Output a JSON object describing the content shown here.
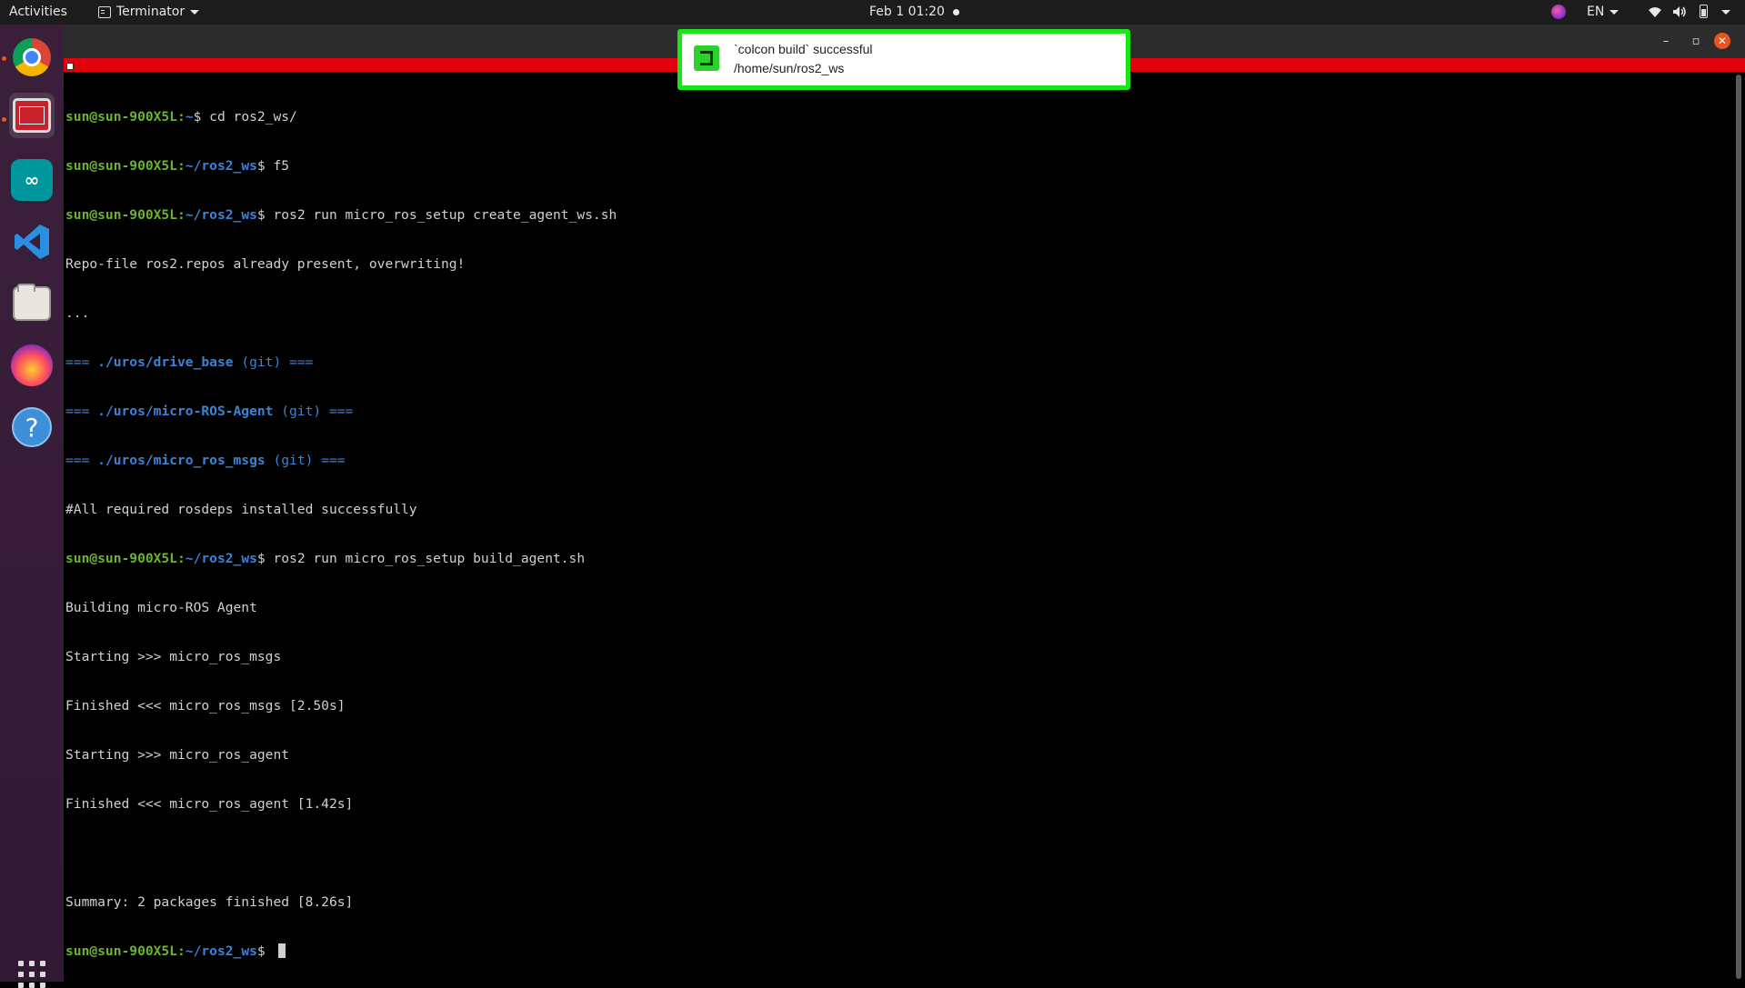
{
  "topbar": {
    "activities": "Activities",
    "app_name": "Terminator",
    "clock": "Feb 1  01:20",
    "language": "EN"
  },
  "dock": {
    "items": [
      {
        "name": "Google Chrome",
        "icon": "chrome-icon",
        "running": true
      },
      {
        "name": "Terminator",
        "icon": "terminator-icon",
        "running": true,
        "active": true
      },
      {
        "name": "Arduino IDE",
        "icon": "arduino-icon"
      },
      {
        "name": "Visual Studio Code",
        "icon": "vscode-icon"
      },
      {
        "name": "Files",
        "icon": "files-icon"
      },
      {
        "name": "Polar",
        "icon": "polar-icon"
      },
      {
        "name": "Help",
        "icon": "help-icon"
      }
    ],
    "show_apps": "apps-grid-icon"
  },
  "notification": {
    "title": "`colcon build` successful",
    "body": "/home/sun/ros2_ws",
    "icon": "colcon-notify-icon",
    "border_color": "#19e619"
  },
  "terminal": {
    "colors": {
      "prompt": "#6ab628",
      "path": "#3a84d6",
      "text": "#d0d0d0",
      "titlebar": "#e0000e"
    },
    "user_host": "sun@sun-900X5L",
    "lines": [
      {
        "p1": "sun@sun-900X5L",
        "p2": ":",
        "path": "~",
        "cmd": "$ cd ros2_ws/"
      },
      {
        "p1": "sun@sun-900X5L",
        "p2": ":",
        "path": "~/ros2_ws",
        "cmd": "$ f5"
      },
      {
        "p1": "sun@sun-900X5L",
        "p2": ":",
        "path": "~/ros2_ws",
        "cmd": "$ ros2 run micro_ros_setup create_agent_ws.sh"
      },
      {
        "text": "Repo-file ros2.repos already present, overwriting!"
      },
      {
        "text": "..."
      },
      {
        "eq": "=== ",
        "repo": "./uros/drive_base",
        "git": " (git) ==="
      },
      {
        "eq": "=== ",
        "repo": "./uros/micro-ROS-Agent",
        "git": " (git) ==="
      },
      {
        "eq": "=== ",
        "repo": "./uros/micro_ros_msgs",
        "git": " (git) ==="
      },
      {
        "text": "#All required rosdeps installed successfully"
      },
      {
        "p1": "sun@sun-900X5L",
        "p2": ":",
        "path": "~/ros2_ws",
        "cmd": "$ ros2 run micro_ros_setup build_agent.sh"
      },
      {
        "text": "Building micro-ROS Agent"
      },
      {
        "text": "Starting >>> micro_ros_msgs"
      },
      {
        "text": "Finished <<< micro_ros_msgs [2.50s]"
      },
      {
        "text": "Starting >>> micro_ros_agent"
      },
      {
        "text": "Finished <<< micro_ros_agent [1.42s]"
      },
      {
        "text": ""
      },
      {
        "text": "Summary: 2 packages finished [8.26s]"
      },
      {
        "p1": "sun@sun-900X5L",
        "p2": ":",
        "path": "~/ros2_ws",
        "cmd": "$ "
      }
    ]
  }
}
